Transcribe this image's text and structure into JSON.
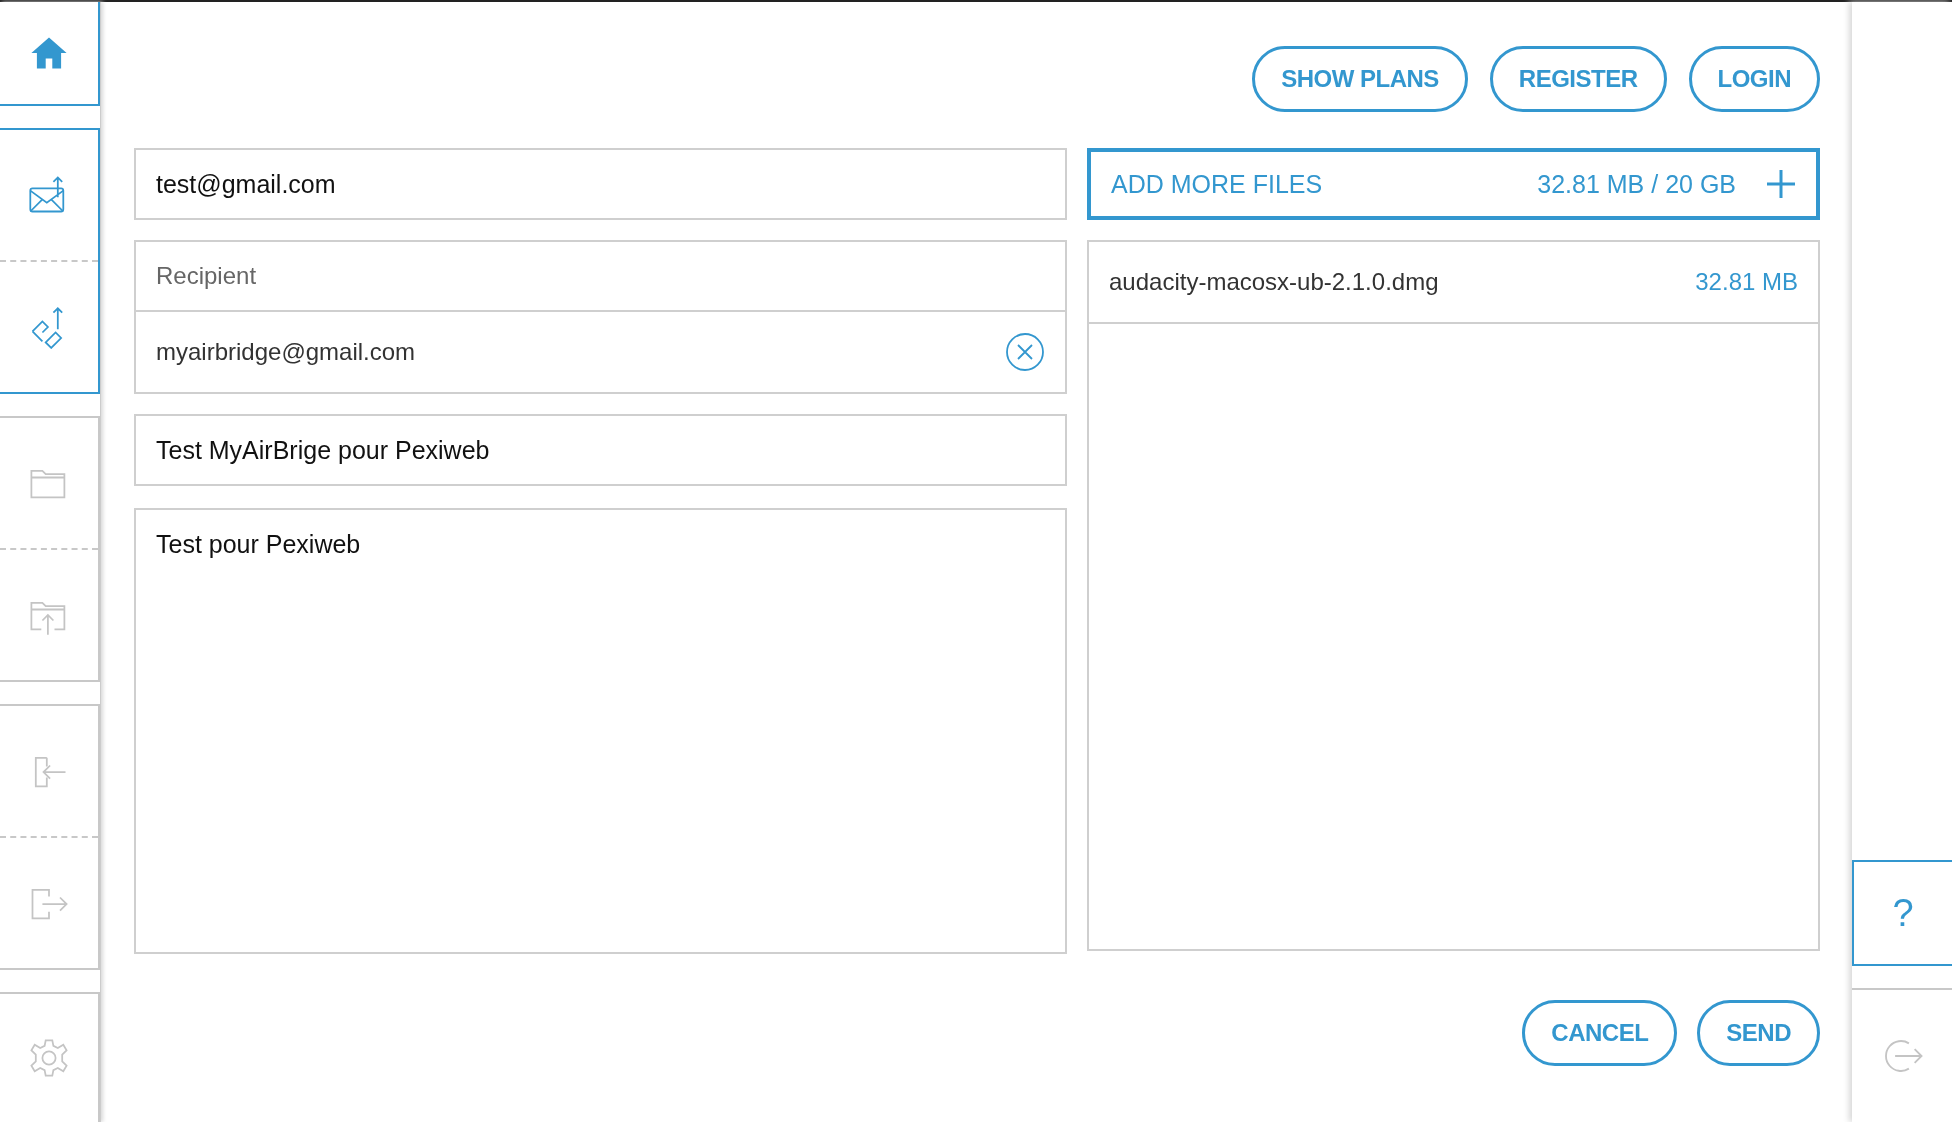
{
  "sidebar": {
    "groups": [
      {
        "active": true,
        "items": [
          {
            "kind": "home"
          }
        ]
      },
      {
        "active": true,
        "items": [
          {
            "kind": "send-mail"
          },
          {
            "kind": "transfer"
          }
        ]
      },
      {
        "active": false,
        "items": [
          {
            "kind": "folder"
          },
          {
            "kind": "folder-upload"
          }
        ]
      },
      {
        "active": false,
        "items": [
          {
            "kind": "sign-in"
          },
          {
            "kind": "sign-out"
          }
        ]
      },
      {
        "active": false,
        "items": [
          {
            "kind": "settings"
          }
        ]
      }
    ]
  },
  "header_buttons": [
    "SHOW PLANS",
    "REGISTER",
    "LOGIN"
  ],
  "form": {
    "sender": {
      "value": "test@gmail.com"
    },
    "recipient": {
      "placeholder": "Recipient"
    },
    "recipients": [
      {
        "email": "myairbridge@gmail.com"
      }
    ],
    "subject": {
      "value": "Test MyAirBrige pour Pexiweb"
    },
    "message": {
      "value": "Test pour Pexiweb"
    }
  },
  "files": {
    "add_label": "ADD MORE FILES",
    "usage": "32.81 MB / 20 GB",
    "items": [
      {
        "name": "audacity-macosx-ub-2.1.0.dmg",
        "size": "32.81 MB"
      }
    ]
  },
  "footer_buttons": [
    "CANCEL",
    "SEND"
  ],
  "right_rail": {
    "help": "?"
  }
}
